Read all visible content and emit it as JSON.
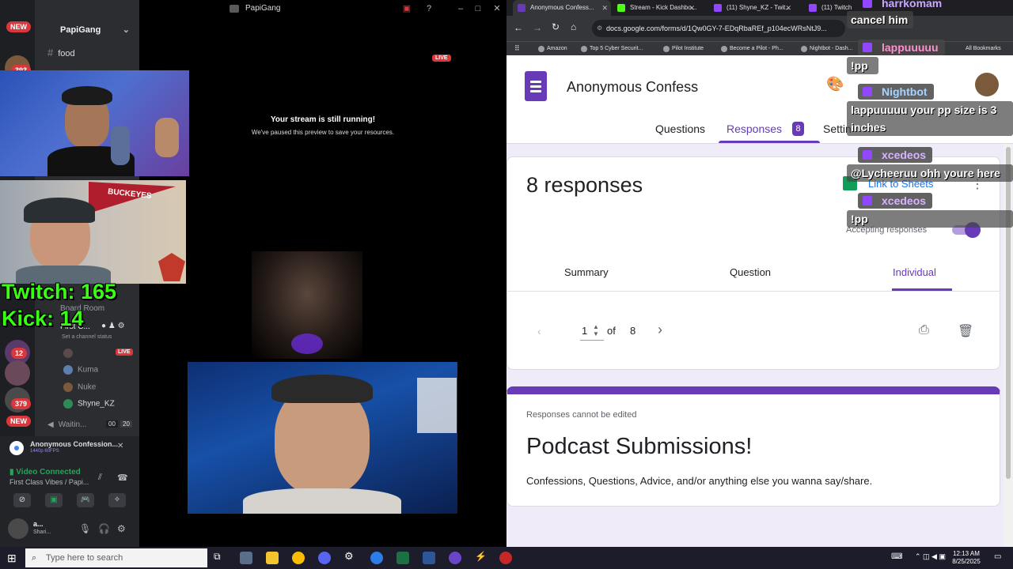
{
  "discord": {
    "window_title": "PapiGang",
    "server_name": "PapiGang",
    "channels": [
      {
        "label": "food"
      },
      {
        "label": "Board Room"
      },
      {
        "label": "First C..."
      },
      {
        "label": "Set a channel status"
      }
    ],
    "voice_users": [
      {
        "name": "Kuma"
      },
      {
        "name": "Nuke"
      },
      {
        "name": "Shyne_KZ"
      }
    ],
    "guild_badges": [
      "NEW",
      "393",
      "12",
      "379",
      "NEW"
    ],
    "waiting_label": "Waitin...",
    "waiting_counts": [
      "00",
      "20"
    ],
    "live_badge": "LIVE",
    "stream_paused_title": "Your stream is still running!",
    "stream_paused_sub": "We've paused this preview to save your resources.",
    "stream_live_badge": "LIVE",
    "activity_title": "Anonymous Confession...",
    "activity_sub": "1440p 60FPS",
    "video_connected": "Video Connected",
    "video_connected_sub": "First Class Vibes / Papi...",
    "user_short": "a...",
    "user_status": "Shari...",
    "twitch_count": "Twitch: 165",
    "kick_count": "Kick: 14",
    "cam_pennant": "BUCKEYES"
  },
  "browser": {
    "tabs": [
      {
        "label": "Anonymous Confess...",
        "color": "#673ab7",
        "active": true
      },
      {
        "label": "Stream - Kick Dashbo...",
        "color": "#53fc18",
        "active": false
      },
      {
        "label": "(11) Shyne_KZ - Twit...",
        "color": "#9147ff",
        "active": false
      },
      {
        "label": "(11) Twitch",
        "color": "#9147ff",
        "active": false
      }
    ],
    "url": "docs.google.com/forms/d/1Qw0GY-7-EDqRbaREf_p104ecWRsNtJ9...",
    "bookmarks": [
      "Amazon",
      "Top 5 Cyber Securit...",
      "Pilot Institute",
      "Become a Pilot - Ph...",
      "Nightbot - Dash..."
    ],
    "all_bookmarks": "All Bookmarks"
  },
  "form": {
    "title": "Anonymous Confess",
    "tabs": [
      "Questions",
      "Responses",
      "Settin"
    ],
    "response_badge": "8",
    "responses_heading": "8 responses",
    "link_to_sheets": "Link to Sheets",
    "accepting_label": "Accepting responses",
    "subtabs": [
      "Summary",
      "Question",
      "Individual"
    ],
    "pager_current": "1",
    "pager_of": "of",
    "pager_total": "8",
    "cannot_edit": "Responses cannot be edited",
    "form_name": "Podcast Submissions!",
    "form_description": "Confessions, Questions, Advice, and/or anything else you wanna say/share."
  },
  "chat": [
    {
      "type": "name",
      "text": "harrkomam"
    },
    {
      "type": "msg",
      "text": "cancel him"
    },
    {
      "type": "name",
      "text": "lappuuuuu"
    },
    {
      "type": "msg",
      "text": "!pp"
    },
    {
      "type": "name",
      "text": "Nightbot"
    },
    {
      "type": "msg",
      "text": "lappuuuuu your pp size is 3 inches"
    },
    {
      "type": "name",
      "text": "xcedeos"
    },
    {
      "type": "msg",
      "text": "@Lycheeruu ohh youre here"
    },
    {
      "type": "name",
      "text": "xcedeos"
    },
    {
      "type": "msg",
      "text": "!pp"
    }
  ],
  "taskbar": {
    "search_placeholder": "Type here to search",
    "time": "12:13 AM",
    "date": "8/25/2025"
  },
  "colors": {
    "accent": "#673ab7",
    "overlay_green": "#39ff14",
    "discord_red": "#da373c"
  }
}
